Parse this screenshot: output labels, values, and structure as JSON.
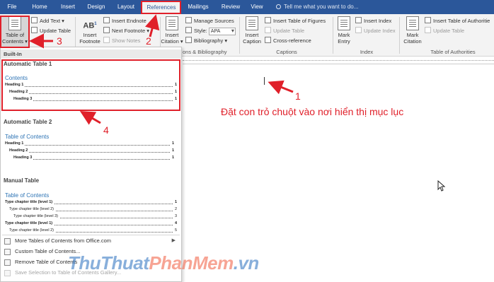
{
  "tabs": [
    {
      "label": "File"
    },
    {
      "label": "Home"
    },
    {
      "label": "Insert"
    },
    {
      "label": "Design"
    },
    {
      "label": "Layout"
    },
    {
      "label": "References"
    },
    {
      "label": "Mailings"
    },
    {
      "label": "Review"
    },
    {
      "label": "View"
    }
  ],
  "tell_me": "Tell me what you want to do...",
  "ribbon": {
    "toc": {
      "line1": "Table of",
      "line2": "Contents",
      "add_text": "Add Text",
      "update_table": "Update Table"
    },
    "footnotes": {
      "insert_footnote_line1": "Insert",
      "insert_footnote_line2": "Footnote",
      "insert_endnote": "Insert Endnote",
      "next_footnote": "Next Footnote",
      "show_notes": "Show Notes",
      "ab_icon_text": "AB",
      "ab_icon_sup": "1"
    },
    "citations": {
      "insert_citation_line1": "Insert",
      "insert_citation_line2": "Citation",
      "manage_sources": "Manage Sources",
      "style_label": "Style:",
      "style_value": "APA",
      "bibliography": "Bibliography",
      "group_label": "ons & Bibliography"
    },
    "captions": {
      "insert_caption_line1": "Insert",
      "insert_caption_line2": "Caption",
      "insert_table_of_figures": "Insert Table of Figures",
      "update_table": "Update Table",
      "cross_reference": "Cross-reference",
      "group_label": "Captions"
    },
    "index": {
      "mark_entry_line1": "Mark",
      "mark_entry_line2": "Entry",
      "insert_index": "Insert Index",
      "update_index": "Update Index",
      "group_label": "Index"
    },
    "authorities": {
      "mark_citation_line1": "Mark",
      "mark_citation_line2": "Citation",
      "insert_table_of_authorities": "Insert Table of Authoritie",
      "update_table": "Update Table",
      "group_label": "Table of Authorities"
    }
  },
  "gallery": {
    "section_label": "Built-In",
    "auto1": {
      "title": "Automatic Table 1",
      "heading": "Contents",
      "lines": [
        {
          "text": "Heading 1",
          "page": "1"
        },
        {
          "text": "Heading 2",
          "page": "1"
        },
        {
          "text": "Heading 3",
          "page": "1"
        }
      ]
    },
    "auto2": {
      "title": "Automatic Table 2",
      "heading": "Table of Contents",
      "lines": [
        {
          "text": "Heading 1",
          "page": "1"
        },
        {
          "text": "Heading 2",
          "page": "1"
        },
        {
          "text": "Heading 3",
          "page": "1"
        }
      ]
    },
    "manual": {
      "title": "Manual Table",
      "heading": "Table of Contents",
      "lines": [
        {
          "text": "Type chapter title (level 1)",
          "page": "1"
        },
        {
          "text": "Type chapter title (level 2)",
          "page": "2"
        },
        {
          "text": "Type chapter title (level 3)",
          "page": "3"
        },
        {
          "text": "Type chapter title (level 1)",
          "page": "4"
        },
        {
          "text": "Type chapter title (level 2)",
          "page": "5"
        }
      ]
    },
    "menu": [
      {
        "label": "More Tables of Contents from Office.com",
        "dim": false
      },
      {
        "label": "Custom Table of Contents...",
        "dim": false
      },
      {
        "label": "Remove Table of Contents",
        "dim": false
      },
      {
        "label": "Save Selection to Table of Contents Gallery...",
        "dim": true
      }
    ]
  },
  "annotations": {
    "n1": "1",
    "n2": "2",
    "n3": "3",
    "n4": "4",
    "instruction": "Đặt con trỏ chuột vào nơi hiển thị mục lục",
    "watermark_a": "ThuThuat",
    "watermark_b": "PhanMem",
    "watermark_c": ".vn",
    "color": "#e0202a"
  }
}
